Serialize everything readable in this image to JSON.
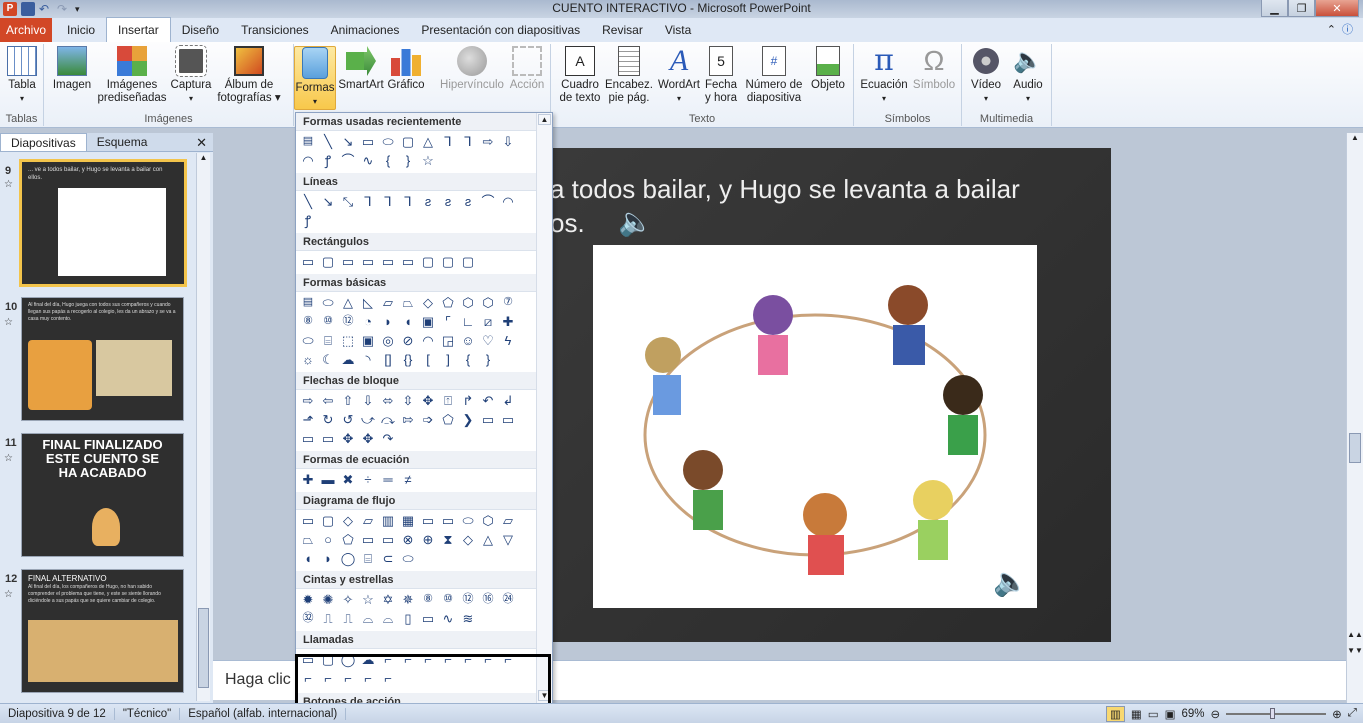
{
  "window": {
    "title": "CUENTO INTERACTIVO  -  Microsoft PowerPoint"
  },
  "tabs": [
    "Archivo",
    "Inicio",
    "Insertar",
    "Diseño",
    "Transiciones",
    "Animaciones",
    "Presentación con diapositivas",
    "Revisar",
    "Vista"
  ],
  "ribbon": {
    "groups": {
      "tablas": "Tablas",
      "imagenes": "Imágenes",
      "texto": "Texto",
      "simbolos": "Símbolos",
      "multimedia": "Multimedia"
    },
    "buttons": {
      "tabla": "Tabla",
      "imagen": "Imagen",
      "imagenes_pred_1": "Imágenes",
      "imagenes_pred_2": "prediseñadas",
      "captura": "Captura",
      "album_1": "Álbum de",
      "album_2": "fotografías",
      "formas": "Formas",
      "smartart": "SmartArt",
      "grafico": "Gráfico",
      "hipervinculo": "Hipervínculo",
      "accion": "Acción",
      "cuadro_1": "Cuadro",
      "cuadro_2": "de texto",
      "encab_1": "Encabez.",
      "encab_2": "pie pág.",
      "wordart": "WordArt",
      "fecha_1": "Fecha",
      "fecha_2": "y hora",
      "numero_1": "Número de",
      "numero_2": "diapositiva",
      "objeto": "Objeto",
      "ecuacion": "Ecuación",
      "simbolo": "Símbolo",
      "video": "Vídeo",
      "audio": "Audio"
    }
  },
  "left_panel": {
    "tabs": [
      "Diapositivas",
      "Esquema"
    ],
    "slides": [
      {
        "num": "9",
        "text": "... ve a todos bailar, y Hugo se levanta a bailar con ellos."
      },
      {
        "num": "10",
        "text": "Al final del día, Hugo juega con todos sus compañeros y cuando llegan sus papás a recogerlo al colegio, les da un abrazo y se va a casa muy contento."
      },
      {
        "num": "11",
        "text": "FINAL FINALIZADO ESTE CUENTO SE HA  ACABADO"
      },
      {
        "num": "12",
        "title": "FINAL ALTERNATIVO",
        "text": "Al final del día, los compañeros de Hugo, no han sabido comprender el problema que tiene, y este se siente llorando diciéndole a sus papás que se quiere cambiar de colegio."
      }
    ]
  },
  "slide": {
    "line1": "a todos bailar, y Hugo se levanta a bailar",
    "line2": "os."
  },
  "notes": {
    "placeholder": "Haga clic"
  },
  "gallery": {
    "sections": [
      "Formas usadas recientemente",
      "Líneas",
      "Rectángulos",
      "Formas básicas",
      "Flechas de bloque",
      "Formas de ecuación",
      "Diagrama de flujo",
      "Cintas y estrellas",
      "Llamadas",
      "Botones de acción"
    ]
  },
  "status": {
    "slide": "Diapositiva 9 de 12",
    "theme": "\"Técnico\"",
    "lang": "Español (alfab. internacional)",
    "zoom": "69%"
  }
}
